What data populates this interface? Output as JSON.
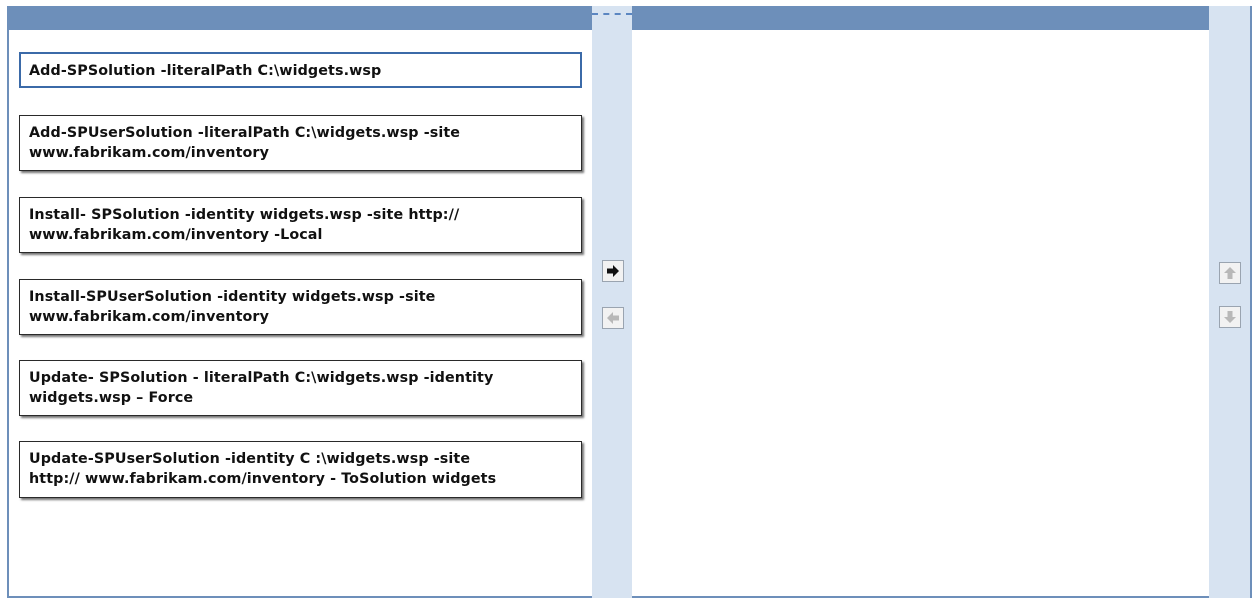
{
  "answer_choices": [
    {
      "text": "Add-SPSolution -literalPath C:\\widgets.wsp",
      "selected": true
    },
    {
      "text": "Add-SPUserSolution -literalPath C:\\widgets.wsp -site\nwww.fabrikam.com/inventory",
      "selected": false
    },
    {
      "text": "Install- SPSolution -identity widgets.wsp -site http://\nwww.fabrikam.com/inventory -Local",
      "selected": false
    },
    {
      "text": "Install-SPUserSolution -identity widgets.wsp -site\nwww.fabrikam.com/inventory",
      "selected": false
    },
    {
      "text": "Update- SPSolution - literalPath C:\\widgets.wsp -identity\nwidgets.wsp – Force",
      "selected": false
    },
    {
      "text": "Update-SPUserSolution -identity C :\\widgets.wsp -site\nhttp:// www.fabrikam.com/inventory - ToSolution widgets",
      "selected": false
    }
  ],
  "answer_area": {
    "items": []
  },
  "controls": {
    "move_right_icon": "arrow-right-icon",
    "move_left_icon": "arrow-left-icon",
    "move_up_icon": "arrow-up-icon",
    "move_down_icon": "arrow-down-icon",
    "move_right_enabled": true,
    "move_left_enabled": false,
    "move_up_enabled": false,
    "move_down_enabled": false
  },
  "colors": {
    "header": "#6d8fba",
    "gutter": "#d7e3f1",
    "selected_border": "#3b6aa8"
  }
}
